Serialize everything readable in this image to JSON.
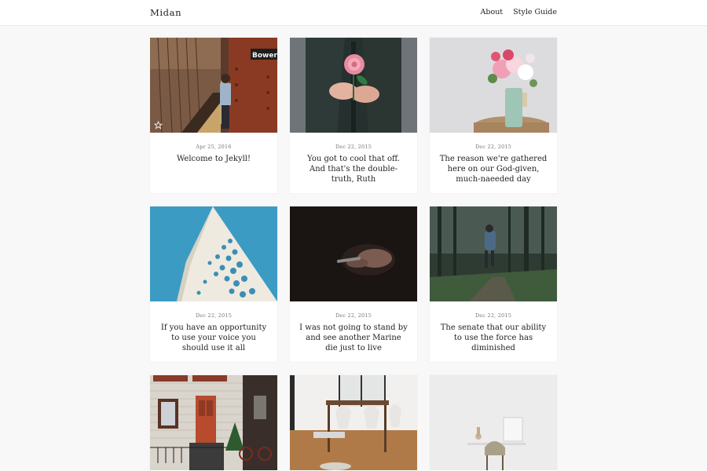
{
  "site": {
    "brand": "Midan"
  },
  "nav": [
    {
      "label": "About"
    },
    {
      "label": "Style Guide"
    }
  ],
  "posts": [
    {
      "date": "Apr 25, 2016",
      "title": "Welcome to Jekyll!",
      "featured": true
    },
    {
      "date": "Dec 22, 2015",
      "title": "You got to cool that off. And that's the double-truth, Ruth"
    },
    {
      "date": "Dec 22, 2015",
      "title": "The reason we're gathered here on our God-given, much-naeeded day"
    },
    {
      "date": "Dec 22, 2015",
      "title": "If you have an opportunity to use your voice you should use it all"
    },
    {
      "date": "Dec 22, 2015",
      "title": "I was not going to stand by and see another Marine die just to live"
    },
    {
      "date": "Dec 22, 2015",
      "title": "The senate that our ability to use the force has diminished"
    },
    {
      "date": "",
      "title": ""
    },
    {
      "date": "",
      "title": ""
    },
    {
      "date": "",
      "title": ""
    }
  ],
  "colors": {
    "page_bg": "#f8f8f8",
    "card_bg": "#ffffff",
    "text": "#222222",
    "meta": "#777777"
  }
}
